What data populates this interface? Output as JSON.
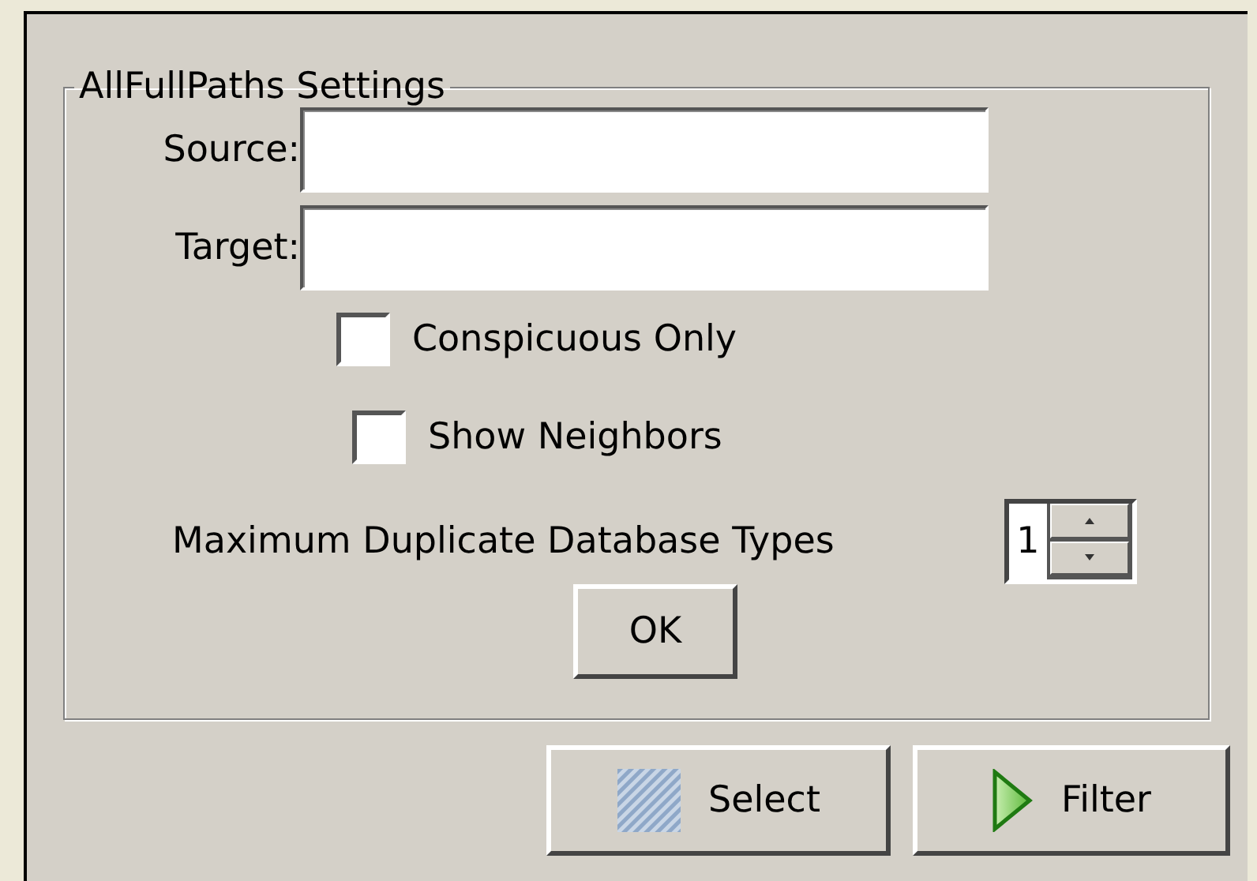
{
  "group": {
    "title": "AllFullPaths Settings"
  },
  "fields": [
    {
      "label": "Source:"
    },
    {
      "label": "Target:"
    }
  ],
  "checkboxes": [
    {
      "label": "Conspicuous Only",
      "checked": false
    },
    {
      "label": "Show Neighbors",
      "checked": false
    }
  ],
  "spinner": {
    "label": "Maximum Duplicate Database Types",
    "value": "1"
  },
  "ok_button": "OK",
  "buttons": [
    {
      "label": "Select",
      "kind": "select"
    },
    {
      "label": "Filter",
      "kind": "filter"
    }
  ]
}
